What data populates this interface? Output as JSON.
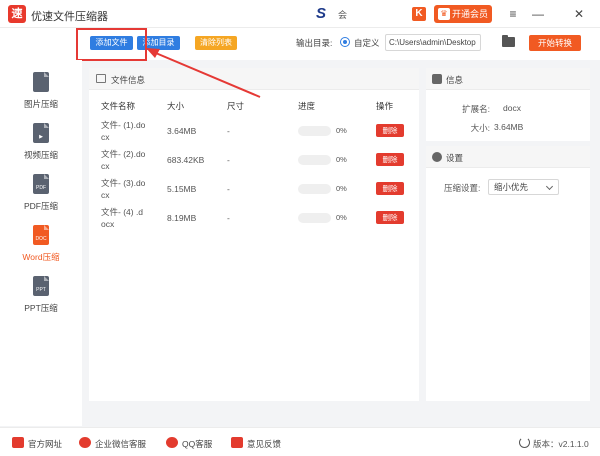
{
  "titlebar": {
    "logo_char": "速",
    "title": "优速文件压缩器",
    "user_name": "会",
    "vip_label": "开通会员",
    "k_icon_char": "K",
    "buttons": {
      "menu": "≡",
      "minimize": "—",
      "close": "✕"
    }
  },
  "toolbar": {
    "add_file": "添加文件",
    "add_dir": "添加目录",
    "clear_list": "清除列表",
    "output_label": "输出目录:",
    "custom_label": "自定义",
    "output_path": "C:\\Users\\admin\\Desktop",
    "start": "开始转换"
  },
  "sidebar": {
    "items": [
      {
        "label": "图片压缩",
        "icon_text": "",
        "active": false
      },
      {
        "label": "视频压缩",
        "icon_text": "▶",
        "active": false
      },
      {
        "label": "PDF压缩",
        "icon_text": "PDF",
        "active": false
      },
      {
        "label": "Word压缩",
        "icon_text": "DOC",
        "active": true
      },
      {
        "label": "PPT压缩",
        "icon_text": "PPT",
        "active": false
      }
    ]
  },
  "file_panel": {
    "title": "文件信息",
    "columns": {
      "name": "文件名称",
      "size": "大小",
      "dimension": "尺寸",
      "progress": "进度",
      "action": "操作"
    },
    "rows": [
      {
        "name_line1": "文件- (1).do",
        "name_line2": "cx",
        "size": "3.64MB",
        "dimension": "-",
        "progress": 0,
        "progress_label": "0%",
        "action": "删除"
      },
      {
        "name_line1": "文件- (2).do",
        "name_line2": "cx",
        "size": "683.42KB",
        "dimension": "-",
        "progress": 0,
        "progress_label": "0%",
        "action": "删除"
      },
      {
        "name_line1": "文件- (3).do",
        "name_line2": "cx",
        "size": "5.15MB",
        "dimension": "-",
        "progress": 0,
        "progress_label": "0%",
        "action": "删除"
      },
      {
        "name_line1": "文件- (4) .d",
        "name_line2": "ocx",
        "size": "8.19MB",
        "dimension": "-",
        "progress": 0,
        "progress_label": "0%",
        "action": "删除"
      }
    ]
  },
  "info_panel": {
    "title": "信息",
    "ext_label": "扩展名:",
    "ext_value": "docx",
    "size_label": "大小:",
    "size_value": "3.64MB"
  },
  "settings_panel": {
    "title": "设置",
    "compress_label": "压缩设置:",
    "compress_value": "缩小优先"
  },
  "footer": {
    "website": "官方网址",
    "wechat": "企业微信客服",
    "qq": "QQ客服",
    "feedback": "意见反馈",
    "version": "版本：v2.1.1.0"
  },
  "colors": {
    "accent_blue": "#2f7de1",
    "accent_orange": "#f15a22",
    "delete_red": "#e33b2e",
    "annotation_red": "#e53935"
  }
}
